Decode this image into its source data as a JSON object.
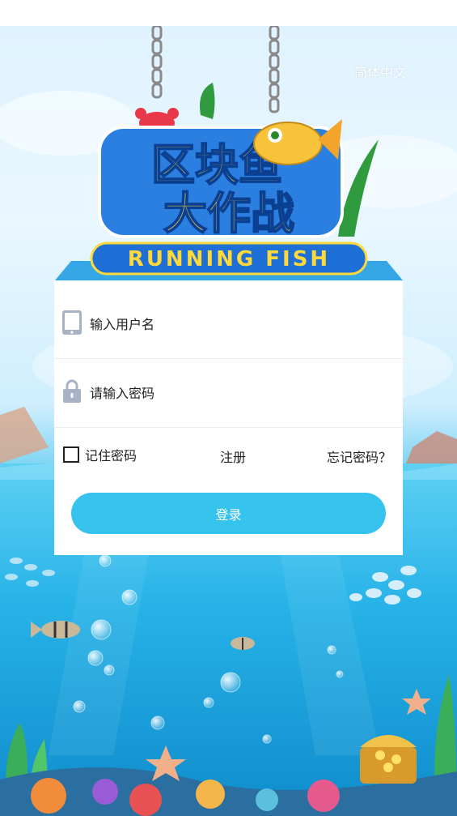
{
  "header": {
    "language_label": "简体中文"
  },
  "logo": {
    "title_line1": "区块鱼",
    "title_line2": "大作战",
    "subtitle": "RUNNING FISH"
  },
  "form": {
    "username_placeholder": "输入用户名",
    "password_placeholder": "请输入密码",
    "remember_label": "记住密码",
    "register_label": "注册",
    "forgot_label": "忘记密码？",
    "login_label": "登录"
  },
  "colors": {
    "accent": "#36c3ee",
    "logo_banner": "#1e6fd6",
    "logo_text": "#ffd83a"
  },
  "icons": {
    "username": "phone-icon",
    "password": "lock-icon"
  }
}
